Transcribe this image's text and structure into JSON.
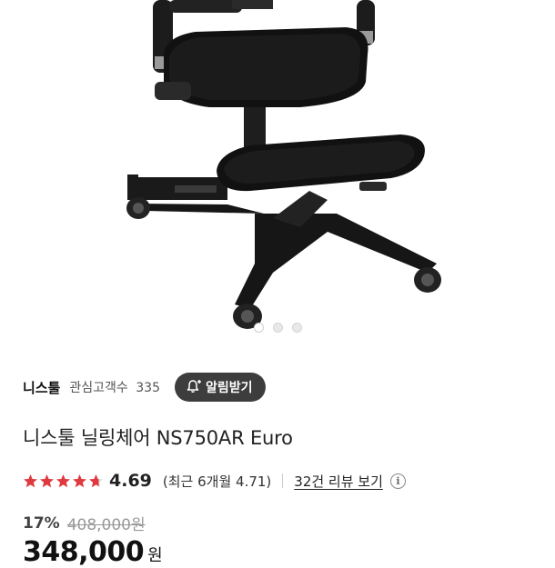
{
  "gallery": {
    "image_alt": "니스툴 닐링체어 NS750AR Euro 제품 이미지",
    "dots": [
      {
        "active": true
      },
      {
        "active": false
      },
      {
        "active": false
      }
    ]
  },
  "brand": {
    "name": "니스툴",
    "interest_label": "관심고객수",
    "interest_count": "335",
    "notify_label": "알림받기"
  },
  "product": {
    "title": "니스툴 닐링체어 NS750AR Euro"
  },
  "rating": {
    "score": "4.69",
    "score_value": 4.69,
    "max_stars": 5,
    "recent_text": "(최근 6개월 4.71)",
    "review_link": "32건 리뷰 보기",
    "star_color": "#e0393e",
    "info_glyph": "i"
  },
  "price": {
    "discount": "17%",
    "original": "408,000원",
    "sale": "348,000",
    "unit": "원"
  },
  "colors": {
    "notify_bg": "#3d3d3d",
    "star": "#e0393e"
  }
}
